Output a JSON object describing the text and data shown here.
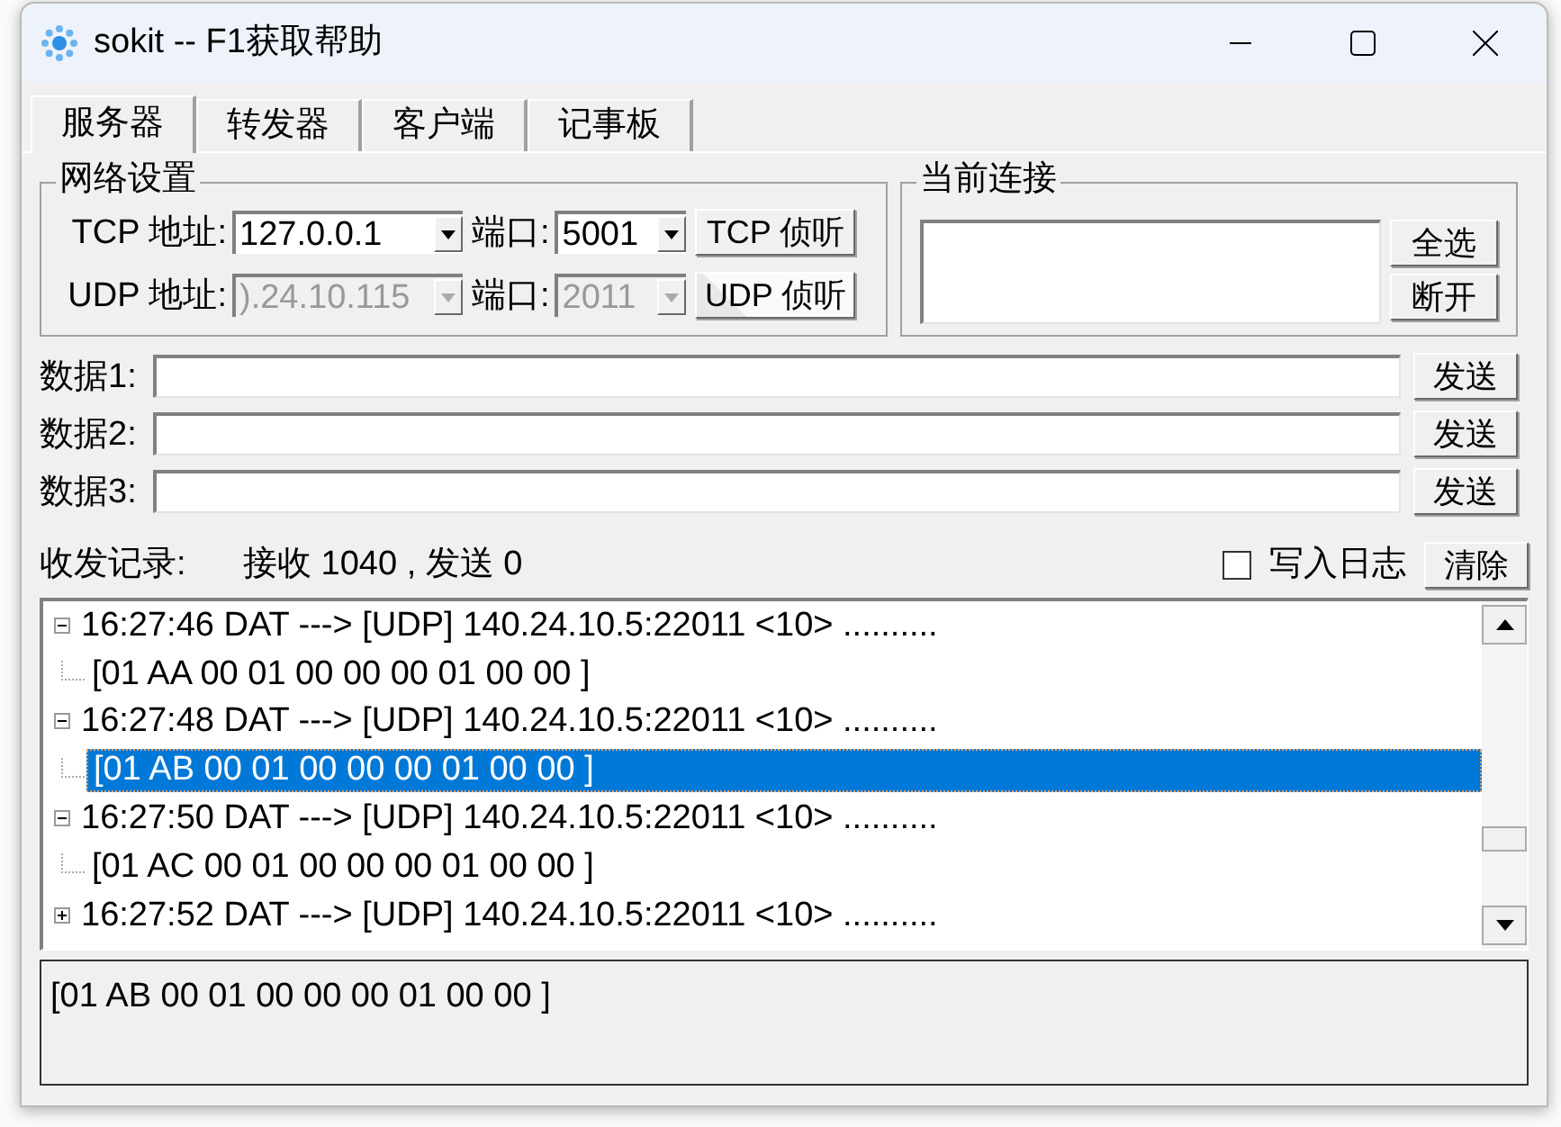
{
  "window": {
    "title": "sokit -- F1获取帮助"
  },
  "tabs": [
    {
      "label": "服务器",
      "selected": true
    },
    {
      "label": "转发器",
      "selected": false
    },
    {
      "label": "客户端",
      "selected": false
    },
    {
      "label": "记事板",
      "selected": false
    }
  ],
  "network_settings": {
    "title": "网络设置",
    "rows": [
      {
        "protocol_label": "TCP 地址:",
        "address": "127.0.0.1",
        "port_label": "端口:",
        "port": "5001",
        "button": "TCP 侦听",
        "disabled": false
      },
      {
        "protocol_label": "UDP 地址:",
        "address": ").24.10.115",
        "port_label": "端口:",
        "port": "2011",
        "button": "UDP 侦听",
        "disabled": true
      }
    ]
  },
  "current_connections": {
    "title": "当前连接",
    "buttons": [
      "全选",
      "断开"
    ]
  },
  "data_rows": [
    {
      "label": "数据1:",
      "button": "发送"
    },
    {
      "label": "数据2:",
      "button": "发送"
    },
    {
      "label": "数据3:",
      "button": "发送"
    }
  ],
  "record": {
    "label": "收发记录:",
    "counts": "接收 1040 , 发送 0",
    "log_checkbox": {
      "label": "写入日志",
      "checked": false
    },
    "clear_button": "清除"
  },
  "log": [
    {
      "text": "16:27:46 DAT ---> [UDP] 140.24.10.5:22011 <10> ..........",
      "expanded": true,
      "children": [
        {
          "text": "[01 AA 00 01 00 00 00 01 00 00 ]",
          "selected": false
        }
      ]
    },
    {
      "text": "16:27:48 DAT ---> [UDP] 140.24.10.5:22011 <10> ..........",
      "expanded": true,
      "children": [
        {
          "text": "[01 AB 00 01 00 00 00 01 00 00 ]",
          "selected": true
        }
      ]
    },
    {
      "text": "16:27:50 DAT ---> [UDP] 140.24.10.5:22011 <10> ..........",
      "expanded": true,
      "children": [
        {
          "text": "[01 AC 00 01 00 00 00 01 00 00 ]",
          "selected": false
        }
      ]
    },
    {
      "text": "16:27:52 DAT ---> [UDP] 140.24.10.5:22011 <10> ..........",
      "expanded": false
    }
  ],
  "detail": "[01 AB 00 01 00 00 00 01 00 00 ]"
}
